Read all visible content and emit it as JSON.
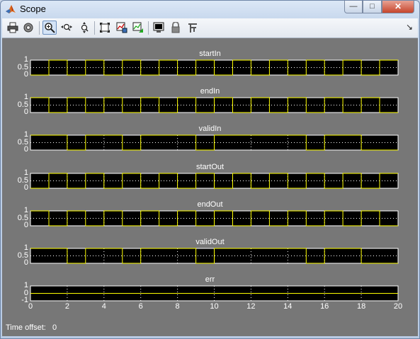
{
  "window": {
    "title": "Scope",
    "minimize_glyph": "—",
    "maximize_glyph": "□",
    "close_glyph": "✕"
  },
  "toolbar": {
    "buttons": [
      {
        "name": "print-icon"
      },
      {
        "name": "parameters-icon"
      },
      {
        "name": "zoom-in-icon",
        "pressed": true
      },
      {
        "name": "zoom-x-icon"
      },
      {
        "name": "zoom-y-icon"
      },
      {
        "name": "autoscale-icon"
      },
      {
        "name": "save-axes-settings-icon"
      },
      {
        "name": "restore-axes-settings-icon"
      },
      {
        "name": "floating-scope-icon"
      },
      {
        "name": "lock-axes-icon"
      },
      {
        "name": "signal-selector-icon"
      }
    ],
    "dock_arrow_glyph": "↘"
  },
  "colors": {
    "background": "#777777",
    "plot_bg": "#000000",
    "trace": "#ffff00",
    "grid": "#ffffff"
  },
  "time_offset": {
    "label": "Time offset:",
    "value": "0"
  },
  "chart_data": [
    {
      "type": "line",
      "title": "startIn",
      "xlim": [
        0,
        20
      ],
      "ylim": [
        0,
        1
      ],
      "yticks": [
        "1",
        "0.5",
        "0"
      ],
      "x": [
        0,
        1,
        1,
        2,
        2,
        3,
        3,
        4,
        4,
        5,
        5,
        6,
        6,
        7,
        7,
        8,
        8,
        9,
        9,
        10,
        10,
        11,
        11,
        12,
        12,
        13,
        13,
        14,
        14,
        15,
        15,
        16,
        16,
        17,
        17,
        18,
        18,
        19,
        19,
        20
      ],
      "y": [
        0,
        0,
        1,
        1,
        0,
        0,
        1,
        1,
        0,
        0,
        1,
        1,
        0,
        0,
        1,
        1,
        0,
        0,
        1,
        1,
        0,
        0,
        1,
        1,
        0,
        0,
        1,
        1,
        0,
        0,
        1,
        1,
        0,
        0,
        1,
        1,
        0,
        0,
        1,
        1
      ]
    },
    {
      "type": "line",
      "title": "endIn",
      "xlim": [
        0,
        20
      ],
      "ylim": [
        0,
        1
      ],
      "yticks": [
        "1",
        "0.5",
        "0"
      ],
      "x": [
        0,
        1,
        1,
        2,
        2,
        3,
        3,
        4,
        4,
        5,
        5,
        6,
        6,
        7,
        7,
        8,
        8,
        9,
        9,
        10,
        10,
        11,
        11,
        12,
        12,
        13,
        13,
        14,
        14,
        15,
        15,
        16,
        16,
        17,
        17,
        18,
        18,
        19,
        19,
        20
      ],
      "y": [
        1,
        1,
        0,
        0,
        1,
        1,
        0,
        0,
        1,
        1,
        0,
        0,
        1,
        1,
        0,
        0,
        1,
        1,
        0,
        0,
        1,
        1,
        0,
        0,
        1,
        1,
        0,
        0,
        1,
        1,
        0,
        0,
        1,
        1,
        0,
        0,
        1,
        1,
        0,
        0
      ]
    },
    {
      "type": "line",
      "title": "validIn",
      "xlim": [
        0,
        20
      ],
      "ylim": [
        0,
        1
      ],
      "yticks": [
        "1",
        "0.5",
        "0"
      ],
      "x": [
        0,
        2,
        2,
        3,
        3,
        5,
        5,
        6,
        6,
        9,
        9,
        10,
        10,
        15,
        15,
        16,
        16,
        18,
        18,
        20
      ],
      "y": [
        1,
        1,
        0,
        0,
        1,
        1,
        0,
        0,
        1,
        1,
        0,
        0,
        1,
        1,
        0,
        0,
        1,
        1,
        0,
        0
      ]
    },
    {
      "type": "line",
      "title": "startOut",
      "xlim": [
        0,
        20
      ],
      "ylim": [
        0,
        1
      ],
      "yticks": [
        "1",
        "0.5",
        "0"
      ],
      "x": [
        0,
        1,
        1,
        2,
        2,
        3,
        3,
        4,
        4,
        5,
        5,
        6,
        6,
        7,
        7,
        8,
        8,
        9,
        9,
        10,
        10,
        11,
        11,
        12,
        12,
        13,
        13,
        14,
        14,
        15,
        15,
        16,
        16,
        17,
        17,
        18,
        18,
        19,
        19,
        20
      ],
      "y": [
        0,
        0,
        1,
        1,
        0,
        0,
        1,
        1,
        0,
        0,
        1,
        1,
        0,
        0,
        1,
        1,
        0,
        0,
        1,
        1,
        0,
        0,
        1,
        1,
        0,
        0,
        1,
        1,
        0,
        0,
        1,
        1,
        0,
        0,
        1,
        1,
        0,
        0,
        1,
        1
      ]
    },
    {
      "type": "line",
      "title": "endOut",
      "xlim": [
        0,
        20
      ],
      "ylim": [
        0,
        1
      ],
      "yticks": [
        "1",
        "0.5",
        "0"
      ],
      "x": [
        0,
        1,
        1,
        2,
        2,
        3,
        3,
        4,
        4,
        5,
        5,
        6,
        6,
        7,
        7,
        8,
        8,
        9,
        9,
        10,
        10,
        11,
        11,
        12,
        12,
        13,
        13,
        14,
        14,
        15,
        15,
        16,
        16,
        17,
        17,
        18,
        18,
        19,
        19,
        20
      ],
      "y": [
        1,
        1,
        0,
        0,
        1,
        1,
        0,
        0,
        1,
        1,
        0,
        0,
        1,
        1,
        0,
        0,
        1,
        1,
        0,
        0,
        1,
        1,
        0,
        0,
        1,
        1,
        0,
        0,
        1,
        1,
        0,
        0,
        1,
        1,
        0,
        0,
        1,
        1,
        0,
        0
      ]
    },
    {
      "type": "line",
      "title": "validOut",
      "xlim": [
        0,
        20
      ],
      "ylim": [
        0,
        1
      ],
      "yticks": [
        "1",
        "0.5",
        "0"
      ],
      "x": [
        0,
        2,
        2,
        3,
        3,
        5,
        5,
        6,
        6,
        9,
        9,
        10,
        10,
        15,
        15,
        16,
        16,
        18,
        18,
        20
      ],
      "y": [
        1,
        1,
        0,
        0,
        1,
        1,
        0,
        0,
        1,
        1,
        0,
        0,
        1,
        1,
        0,
        0,
        1,
        1,
        0,
        0
      ]
    },
    {
      "type": "line",
      "title": "err",
      "xlim": [
        0,
        20
      ],
      "ylim": [
        -1,
        1
      ],
      "yticks": [
        "1",
        "0",
        "-1"
      ],
      "x": [
        0,
        20
      ],
      "y": [
        0,
        0
      ],
      "xticks": [
        "0",
        "2",
        "4",
        "6",
        "8",
        "10",
        "12",
        "14",
        "16",
        "18",
        "20"
      ]
    }
  ]
}
